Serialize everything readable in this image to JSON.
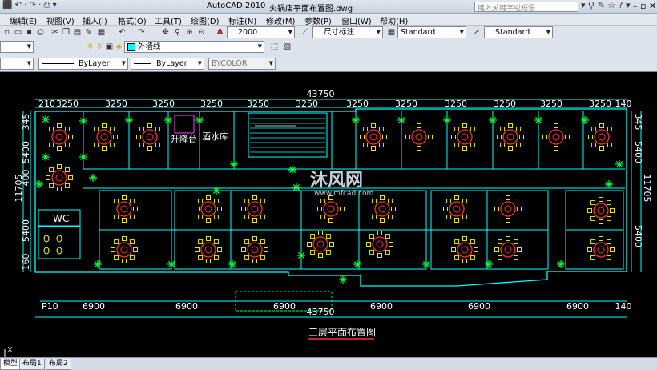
{
  "titlebar": {
    "app_name": "AutoCAD 2010",
    "file_name": "火锅店平面布置图.dwg",
    "search_placeholder": "键入关键字或短语"
  },
  "menu": [
    "编辑(E)",
    "视图(V)",
    "插入(I)",
    "格式(O)",
    "工具(T)",
    "绘图(D)",
    "标注(N)",
    "修改(M)",
    "参数(P)",
    "窗口(W)",
    "帮助(H)"
  ],
  "toolbar": {
    "text_height": "2000",
    "dim_style": "尺寸标注",
    "table_style": "Standard",
    "multileader_style": "Standard"
  },
  "layers": {
    "current_layer": "外墙线",
    "linetype": "ByLayer",
    "lineweight": "ByLayer",
    "plot_style": "BYCOLOR"
  },
  "drawing": {
    "overall_top": "43750",
    "overall_bottom": "43750",
    "top_dims": [
      "210",
      "3250",
      "3250",
      "3250",
      "3250",
      "3250",
      "3250",
      "3250",
      "3250",
      "3250",
      "3250",
      "3250",
      "3250",
      "140"
    ],
    "bottom_dims": [
      "P10",
      "6900",
      "6900",
      "6900",
      "6900",
      "6900",
      "6900",
      "140"
    ],
    "left_dims": [
      "345",
      "5400",
      "400",
      "11705",
      "5400",
      "160"
    ],
    "right_dims": [
      "345",
      "5400",
      "11705",
      "5400"
    ],
    "rooms": {
      "lift": "升降台",
      "wine": "酒水库",
      "wc": "WC"
    },
    "drawing_title": "三层平面布置图",
    "watermark_brand": "沐风网",
    "watermark_url": "www.mfcad.com"
  },
  "command_line": "X",
  "layout_tabs": [
    "模型",
    "布局1",
    "布局2"
  ],
  "colors": {
    "dim": "#00ffff",
    "wall": "#00ffff",
    "table": "#ff3030",
    "chair": "#ffff00",
    "plant": "#00ff40",
    "text": "#ffffff",
    "title_underline": "#ff3030"
  }
}
